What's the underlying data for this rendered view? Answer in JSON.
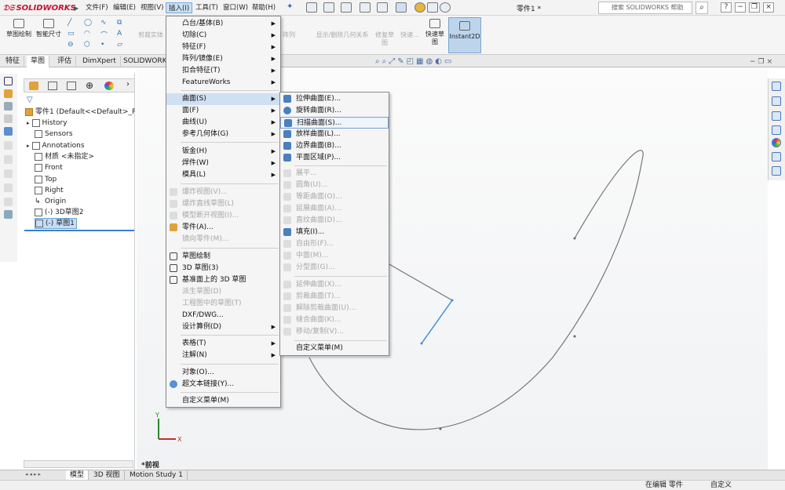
{
  "app": {
    "logo": "SOLIDWORKS",
    "doc_title": "零件1 *",
    "search_placeholder": "搜索 SOLIDWORKS 帮助"
  },
  "menubar": [
    "文件(F)",
    "编辑(E)",
    "视图(V)",
    "插入(I)",
    "工具(T)",
    "窗口(W)",
    "帮助(H)"
  ],
  "ribbon": {
    "sketch": "草图绘制",
    "smart_dim": "智能尺寸",
    "cut": "剪裁实体",
    "array": "阵列",
    "relations": "显示/删除几何关系",
    "repair": "修复草图",
    "quick": "快速...",
    "rapid": "快速草图",
    "instant": "Instant2D"
  },
  "cmd_tabs": [
    "特征",
    "草图",
    "评估",
    "DimXpert",
    "SOLIDWORKS"
  ],
  "tree": {
    "root": "零件1 (Default<<Default>_Ph",
    "items": [
      "History",
      "Sensors",
      "Annotations",
      "材质 <未指定>",
      "Front",
      "Top",
      "Right",
      "Origin",
      "(-) 3D草图2",
      "(-) 草图1"
    ]
  },
  "insert_menu": {
    "items": [
      "凸台/基体(B)",
      "切除(C)",
      "特征(F)",
      "阵列/镜像(E)",
      "扣合特征(T)",
      "FeatureWorks",
      "曲面(S)",
      "面(F)",
      "曲线(U)",
      "参考几何体(G)",
      "钣金(H)",
      "焊件(W)",
      "模具(L)",
      "爆炸视图(V)...",
      "爆炸直线草图(L)",
      "模型断开视图(I)...",
      "零件(A)...",
      "镜向零件(M)...",
      "草图绘制",
      "3D 草图(3)",
      "基准面上的 3D 草图",
      "派生草图(D)",
      "工程图中的草图(T)",
      "DXF/DWG...",
      "设计算例(D)",
      "表格(T)",
      "注解(N)",
      "对象(O)...",
      "超文本链接(Y)...",
      "自定义菜单(M)"
    ]
  },
  "surface_menu": {
    "items": [
      "拉伸曲面(E)...",
      "旋转曲面(R)...",
      "扫描曲面(S)...",
      "放样曲面(L)...",
      "边界曲面(B)...",
      "平面区域(P)...",
      "展平...",
      "圆角(U)...",
      "等距曲面(O)...",
      "延展曲面(A)...",
      "直纹曲面(D)...",
      "填充(I)...",
      "自由形(F)...",
      "中面(M)...",
      "分型面(G)...",
      "延伸曲面(X)...",
      "剪裁曲面(T)...",
      "解除剪裁曲面(U)...",
      "缝合曲面(K)...",
      "移动/复制(V)...",
      "自定义菜单(M)"
    ]
  },
  "triad": {
    "y": "Y",
    "x": "X"
  },
  "view_name": "*前视",
  "bottom_tabs": [
    "模型",
    "3D 视图",
    "Motion Study 1"
  ],
  "status": {
    "editing": "在编辑 零件",
    "custom": "自定义"
  }
}
